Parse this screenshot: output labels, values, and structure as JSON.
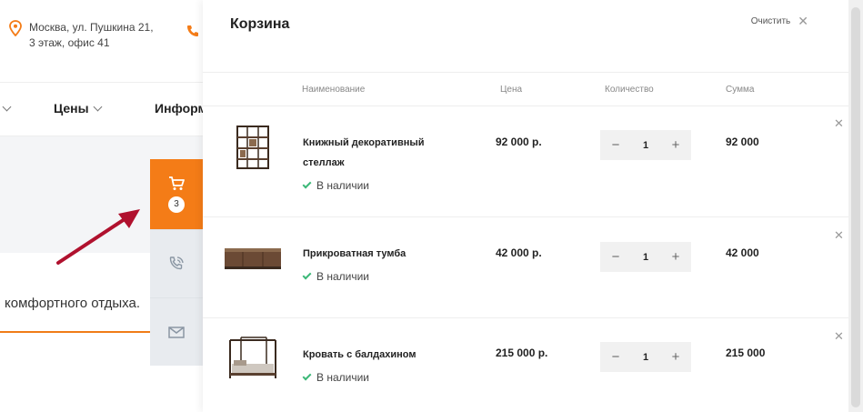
{
  "background": {
    "address_line1": "Москва, ул. Пушкина 21,",
    "address_line2": "3 этаж, офис 41",
    "nav": {
      "prices": "Цены",
      "info": "Информ"
    },
    "promo_text": "комфортного отдыха."
  },
  "side_widget": {
    "cart_count": "3"
  },
  "cart": {
    "title": "Корзина",
    "clear_label": "Очистить",
    "columns": {
      "name": "Наименование",
      "price": "Цена",
      "quantity": "Количество",
      "sum": "Сумма"
    },
    "items": [
      {
        "name": "Книжный декоративный стеллаж",
        "stock": "В наличии",
        "price": "92 000 р.",
        "qty": "1",
        "sum": "92 000"
      },
      {
        "name": "Прикроватная тумба",
        "stock": "В наличии",
        "price": "42 000 р.",
        "qty": "1",
        "sum": "42 000"
      },
      {
        "name": "Кровать с балдахином",
        "stock": "В наличии",
        "price": "215 000 р.",
        "qty": "1",
        "sum": "215 000"
      }
    ]
  },
  "colors": {
    "accent": "#f47c17",
    "in_stock": "#3cb878",
    "arrow": "#b0112e"
  },
  "icons": [
    "location-icon",
    "phone-icon",
    "cart-icon",
    "callback-icon",
    "mail-icon",
    "close-icon",
    "check-icon"
  ]
}
